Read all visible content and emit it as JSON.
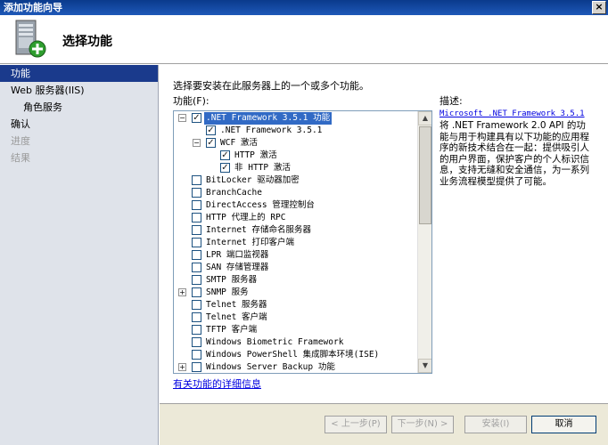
{
  "window": {
    "title": "添加功能向导",
    "close_glyph": "×"
  },
  "header": {
    "title": "选择功能",
    "icon": "server-add-icon"
  },
  "sidebar": {
    "items": [
      {
        "label": "功能",
        "state": "active"
      },
      {
        "label": "Web 服务器(IIS)",
        "state": "normal"
      },
      {
        "label": "角色服务",
        "state": "sub"
      },
      {
        "label": "确认",
        "state": "normal"
      },
      {
        "label": "进度",
        "state": "disabled"
      },
      {
        "label": "结果",
        "state": "disabled"
      }
    ]
  },
  "main": {
    "instruction": "选择要安装在此服务器上的一个或多个功能。",
    "features_label": "功能(F):",
    "description_label": "描述:",
    "description_link": "Microsoft .NET Framework 3.5.1",
    "description_text": "将 .NET Framework 2.0 API 的功能与用于构建具有以下功能的应用程序的新技术结合在一起：提供吸引人的用户界面，保护客户的个人标识信息，支持无缝和安全通信，为一系列业务流程模型提供了可能。",
    "more_info_link": "有关功能的详细信息"
  },
  "features": [
    {
      "label": ".NET Framework 3.5.1 功能",
      "level": 0,
      "checked": true,
      "expander": "−",
      "selected": true
    },
    {
      "label": ".NET Framework 3.5.1",
      "level": 1,
      "checked": true,
      "expander": "",
      "selected": false
    },
    {
      "label": "WCF 激活",
      "level": 1,
      "checked": true,
      "expander": "−",
      "selected": false
    },
    {
      "label": "HTTP 激活",
      "level": 2,
      "checked": true,
      "expander": "",
      "selected": false
    },
    {
      "label": "非 HTTP 激活",
      "level": 2,
      "checked": true,
      "expander": "",
      "selected": false
    },
    {
      "label": "BitLocker 驱动器加密",
      "level": 0,
      "checked": false,
      "expander": "",
      "selected": false
    },
    {
      "label": "BranchCache",
      "level": 0,
      "checked": false,
      "expander": "",
      "selected": false
    },
    {
      "label": "DirectAccess 管理控制台",
      "level": 0,
      "checked": false,
      "expander": "",
      "selected": false
    },
    {
      "label": "HTTP 代理上的 RPC",
      "level": 0,
      "checked": false,
      "expander": "",
      "selected": false
    },
    {
      "label": "Internet 存储命名服务器",
      "level": 0,
      "checked": false,
      "expander": "",
      "selected": false
    },
    {
      "label": "Internet 打印客户端",
      "level": 0,
      "checked": false,
      "expander": "",
      "selected": false
    },
    {
      "label": "LPR 端口监视器",
      "level": 0,
      "checked": false,
      "expander": "",
      "selected": false
    },
    {
      "label": "SAN 存储管理器",
      "level": 0,
      "checked": false,
      "expander": "",
      "selected": false
    },
    {
      "label": "SMTP 服务器",
      "level": 0,
      "checked": false,
      "expander": "",
      "selected": false
    },
    {
      "label": "SNMP 服务",
      "level": 0,
      "checked": false,
      "expander": "+",
      "selected": false
    },
    {
      "label": "Telnet 服务器",
      "level": 0,
      "checked": false,
      "expander": "",
      "selected": false
    },
    {
      "label": "Telnet 客户端",
      "level": 0,
      "checked": false,
      "expander": "",
      "selected": false
    },
    {
      "label": "TFTP 客户端",
      "level": 0,
      "checked": false,
      "expander": "",
      "selected": false
    },
    {
      "label": "Windows Biometric Framework",
      "level": 0,
      "checked": false,
      "expander": "",
      "selected": false
    },
    {
      "label": "Windows PowerShell 集成脚本环境(ISE)",
      "level": 0,
      "checked": false,
      "expander": "",
      "selected": false
    },
    {
      "label": "Windows Server Backup 功能",
      "level": 0,
      "checked": false,
      "expander": "+",
      "selected": false
    }
  ],
  "footer": {
    "prev": "< 上一步(P)",
    "next": "下一步(N) >",
    "install": "安装(I)",
    "cancel": "取消"
  }
}
